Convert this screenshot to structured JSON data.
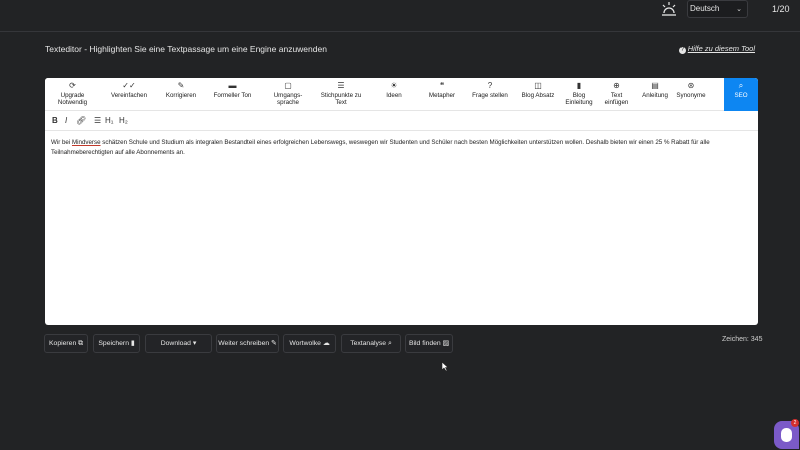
{
  "header": {
    "language": "Deutsch",
    "page_counter": "1/20"
  },
  "page": {
    "title": "Texteditor - Highlighten Sie eine Textpassage um eine Engine anzuwenden",
    "help_link": "Hilfe zu diesem Tool"
  },
  "toolbar": {
    "tools": [
      {
        "label": "Upgrade Notwendig",
        "icon": "refresh-icon"
      },
      {
        "label": "Vereinfachen",
        "icon": "double-check-icon"
      },
      {
        "label": "Korrigieren",
        "icon": "pencil-icon"
      },
      {
        "label": "Formeller Ton",
        "icon": "briefcase-icon"
      },
      {
        "label": "Umgangs-sprache",
        "icon": "bag-icon"
      },
      {
        "label": "Stichpunkte zu Text",
        "icon": "list-icon"
      },
      {
        "label": "Ideen",
        "icon": "lightbulb-icon"
      },
      {
        "label": "Metapher",
        "icon": "quote-icon"
      },
      {
        "label": "Frage stellen",
        "icon": "question-icon"
      },
      {
        "label": "Blog Absatz",
        "icon": "layout-icon"
      },
      {
        "label": "Blog Einleitung",
        "icon": "bookmark-icon"
      },
      {
        "label": "Text einfügen",
        "icon": "plus-circle-icon"
      },
      {
        "label": "Anleitung",
        "icon": "document-icon"
      },
      {
        "label": "Synonyme",
        "icon": "synonym-icon"
      },
      {
        "label": "SEO",
        "icon": "search-icon"
      }
    ]
  },
  "format": {
    "bold": "B",
    "italic": "I",
    "h1": "H₁",
    "h2": "H₂"
  },
  "editor": {
    "text_before": "Wir bei ",
    "brand": "Mindverse",
    "text_after": " schätzen Schule und Studium als integralen Bestandteil eines erfolgreichen Lebenswegs, weswegen wir Studenten und Schüler nach besten Möglichkeiten unterstützen wollen. Deshalb bieten wir einen 25 % Rabatt für alle Teilnahmeberechtigten auf alle Abonnements an."
  },
  "actions": {
    "copy": "Kopieren",
    "save": "Speichern",
    "download": "Download",
    "continue_writing": "Weiter schreiben",
    "word_cloud": "Wortwolke",
    "text_analysis": "Textanalyse",
    "find_image": "Bild finden"
  },
  "char_count": "Zeichen: 345",
  "chat": {
    "badge": "2"
  },
  "colors": {
    "background": "#222325",
    "accent": "#0d86f2",
    "chat": "#7b5ac8"
  }
}
